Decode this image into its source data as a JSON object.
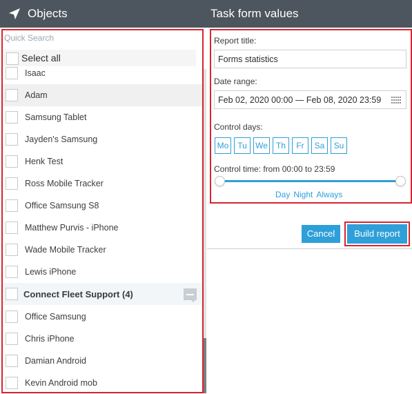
{
  "left": {
    "title": "Objects",
    "search_placeholder": "Quick Search",
    "select_all": "Select all",
    "items": [
      {
        "label": "Isaac"
      },
      {
        "label": "Adam"
      },
      {
        "label": "Samsung Tablet"
      },
      {
        "label": "Jayden's Samsung"
      },
      {
        "label": "Henk Test"
      },
      {
        "label": "Ross Mobile Tracker"
      },
      {
        "label": "Office Samsung S8"
      },
      {
        "label": "Matthew Purvis - iPhone"
      },
      {
        "label": "Wade Mobile Tracker"
      },
      {
        "label": "Lewis iPhone"
      },
      {
        "label": "Connect Fleet Support (4)"
      },
      {
        "label": "Office Samsung"
      },
      {
        "label": "Chris iPhone"
      },
      {
        "label": "Damian Android"
      },
      {
        "label": "Kevin Android mob"
      }
    ]
  },
  "right": {
    "title": "Task form values",
    "report_title_label": "Report title:",
    "report_title_value": "Forms statistics",
    "date_range_label": "Date range:",
    "date_range_value": "Feb 02, 2020 00:00 — Feb 08, 2020 23:59",
    "control_days_label": "Control days:",
    "days": [
      "Mo",
      "Tu",
      "We",
      "Th",
      "Fr",
      "Sa",
      "Su"
    ],
    "control_time_label": "Control time: from 00:00 to 23:59",
    "presets": [
      "Day",
      "Night",
      "Always"
    ],
    "cancel_label": "Cancel",
    "build_label": "Build report"
  },
  "colors": {
    "header_bg": "#4d565e",
    "accent": "#2e9fd8",
    "highlight_border": "#d9232e"
  },
  "icons": [
    "navigation-arrow-icon",
    "calendar-icon",
    "collapse-icon"
  ]
}
